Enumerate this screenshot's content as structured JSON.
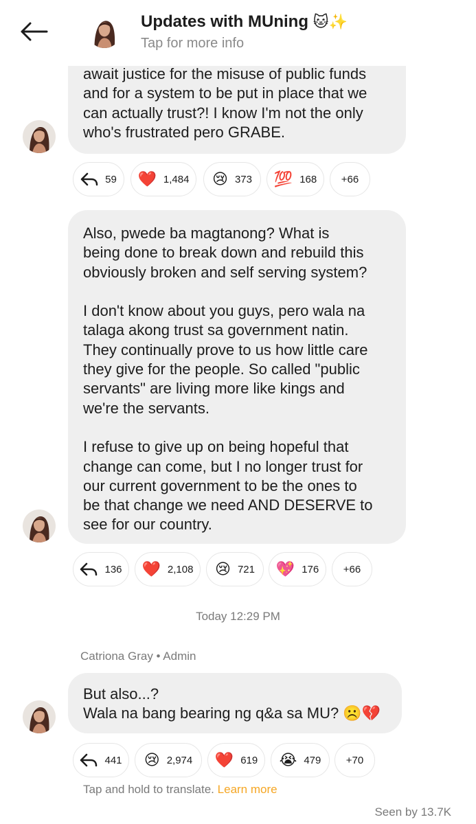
{
  "header": {
    "title": "Updates with MUning",
    "title_emojis": "🐱✨",
    "subtitle": "Tap for more info"
  },
  "messages": [
    {
      "text": "await justice for the misuse of public funds\nand for a system to be put in place that we\ncan actually trust?! I know I'm not the only\nwho's frustrated pero GRABE.",
      "reactions": [
        {
          "icon": "reply-icon",
          "count": "59"
        },
        {
          "icon": "red-heart-emoji",
          "emoji": "❤️",
          "count": "1,484"
        },
        {
          "icon": "crying-face-emoji",
          "emoji": "😢",
          "count": "373"
        },
        {
          "icon": "hundred-points-emoji",
          "emoji": "💯",
          "count": "168"
        },
        {
          "icon": "more-reactions",
          "count": "+66"
        }
      ]
    },
    {
      "text": "Also, pwede ba magtanong? What is\nbeing done to break down and rebuild this\nobviously broken and self serving system?\n\nI don't know about you guys, pero wala na\ntalaga akong trust sa government natin.\nThey continually prove to us how little care\nthey give for the people. So called \"public\nservants\" are living more like kings and\nwe're the servants.\n\nI refuse to give up on being hopeful that\nchange can come, but I no longer trust for\nour current government to be the ones to\nbe that change we need AND DESERVE to\nsee for our country.",
      "reactions": [
        {
          "icon": "reply-icon",
          "count": "136"
        },
        {
          "icon": "red-heart-emoji",
          "emoji": "❤️",
          "count": "2,108"
        },
        {
          "icon": "crying-face-emoji",
          "emoji": "😢",
          "count": "721"
        },
        {
          "icon": "sparkling-heart-emoji",
          "emoji": "💖",
          "count": "176"
        },
        {
          "icon": "more-reactions",
          "count": "+66"
        }
      ]
    },
    {
      "sender": "Catriona Gray • Admin",
      "text": "But also...?\nWala na bang bearing ng q&a sa MU? ☹️💔",
      "reactions": [
        {
          "icon": "reply-icon",
          "count": "441"
        },
        {
          "icon": "crying-face-emoji",
          "emoji": "😢",
          "count": "2,974"
        },
        {
          "icon": "red-heart-emoji",
          "emoji": "❤️",
          "count": "619"
        },
        {
          "icon": "loudly-crying-face-emoji",
          "emoji": "😭",
          "count": "479"
        },
        {
          "icon": "more-reactions",
          "count": "+70"
        }
      ]
    }
  ],
  "timestamp": "Today 12:29 PM",
  "translate": {
    "text": "Tap and hold to translate.",
    "link": "Learn more"
  },
  "seen": "Seen by 13.7K",
  "colors": {
    "bubble": "#efefef",
    "link": "#f5a623",
    "muted": "#7a7a7a"
  }
}
